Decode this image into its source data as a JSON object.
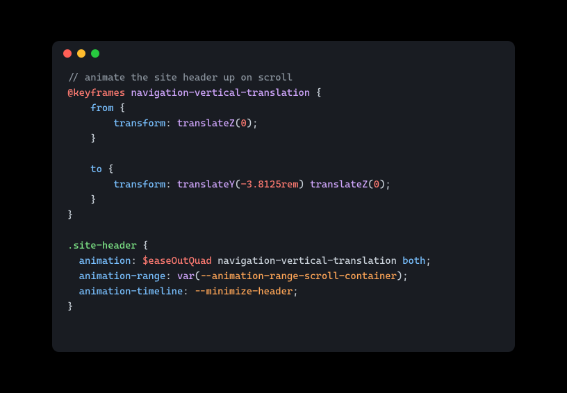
{
  "window": {
    "traffic_lights": [
      "red",
      "yellow",
      "green"
    ]
  },
  "code": {
    "line1_comment": "// animate the site header up on scroll",
    "line2_atrule": "@keyframes",
    "line2_name": "navigation-vertical-translation",
    "line2_open": " {",
    "line3_indent": "    ",
    "line3_from": "from",
    "line3_open": " {",
    "line4_indent": "        ",
    "line4_prop": "transform",
    "line4_colon": ": ",
    "line4_func": "translateZ",
    "line4_open": "(",
    "line4_num": "0",
    "line4_close": ")",
    "line4_semi": ";",
    "line5_indent": "    ",
    "line5_close": "}",
    "line7_indent": "    ",
    "line7_to": "to",
    "line7_open": " {",
    "line8_indent": "        ",
    "line8_prop": "transform",
    "line8_colon": ": ",
    "line8_func1": "translateY",
    "line8_open1": "(",
    "line8_num1": "-3.8125",
    "line8_unit1": "rem",
    "line8_close1": ")",
    "line8_space": " ",
    "line8_func2": "translateZ",
    "line8_open2": "(",
    "line8_num2": "0",
    "line8_close2": ")",
    "line8_semi": ";",
    "line9_indent": "    ",
    "line9_close": "}",
    "line10_close": "}",
    "line12_selector": ".site-header",
    "line12_open": " {",
    "line13_indent": "  ",
    "line13_prop": "animation",
    "line13_colon": ": ",
    "line13_var": "$easeOutQuad",
    "line13_space1": " ",
    "line13_name": "navigation-vertical-translation",
    "line13_space2": " ",
    "line13_both": "both",
    "line13_semi": ";",
    "line14_indent": "  ",
    "line14_prop": "animation-range",
    "line14_colon": ": ",
    "line14_func": "var",
    "line14_open": "(",
    "line14_cssvar": "--animation-range-scroll-container",
    "line14_close": ")",
    "line14_semi": ";",
    "line15_indent": "  ",
    "line15_prop": "animation-timeline",
    "line15_colon": ": ",
    "line15_cssvar": "--minimize-header",
    "line15_semi": ";",
    "line16_close": "}"
  }
}
